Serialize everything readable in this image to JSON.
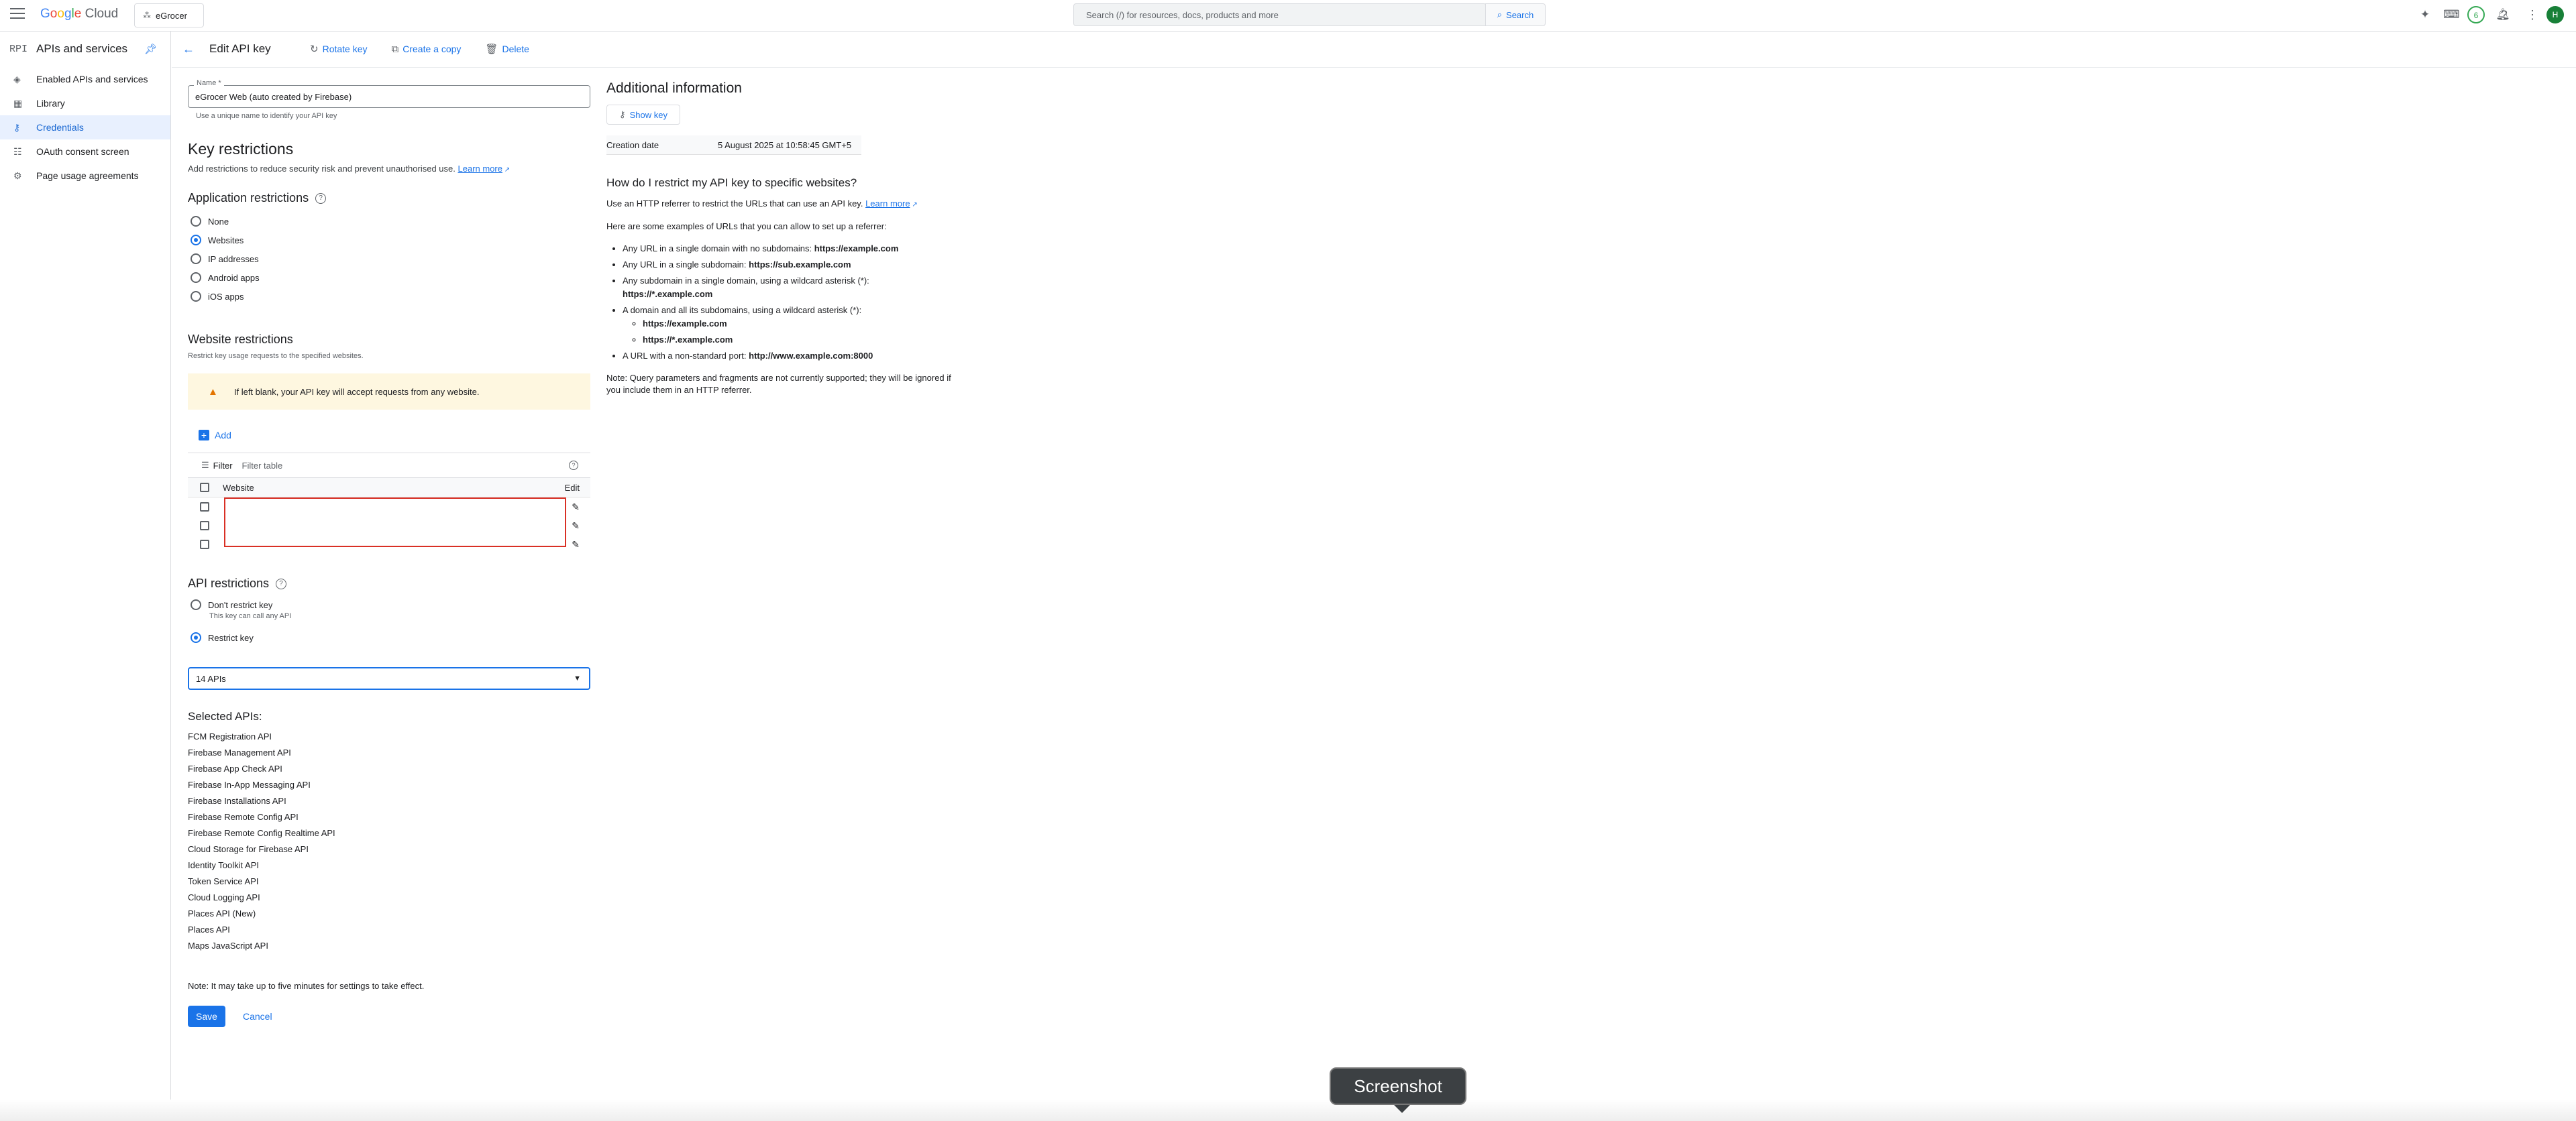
{
  "topbar": {
    "logo": "Google Cloud",
    "project": "eGrocer",
    "search_placeholder": "Search (/) for resources, docs, products and more",
    "search_button": "Search",
    "notifications_count": "6",
    "avatar_letter": "H"
  },
  "sidebar": {
    "icon_text": "RPI",
    "title": "APIs and services",
    "items": [
      {
        "label": "Enabled APIs and services",
        "icon": "diamond-icon"
      },
      {
        "label": "Library",
        "icon": "library-icon"
      },
      {
        "label": "Credentials",
        "icon": "key-icon",
        "active": true
      },
      {
        "label": "OAuth consent screen",
        "icon": "consent-icon"
      },
      {
        "label": "Page usage agreements",
        "icon": "settings-icon"
      }
    ]
  },
  "header": {
    "title": "Edit API key",
    "rotate_key": "Rotate key",
    "create_copy": "Create a copy",
    "delete": "Delete"
  },
  "name_field": {
    "label": "Name *",
    "value": "eGrocer Web (auto created by Firebase)",
    "hint": "Use a unique name to identify your API key"
  },
  "key_restrictions": {
    "title": "Key restrictions",
    "description": "Add restrictions to reduce security risk and prevent unauthorised use.",
    "learn_more": "Learn more"
  },
  "application_restrictions": {
    "title": "Application restrictions",
    "options": [
      "None",
      "Websites",
      "IP addresses",
      "Android apps",
      "iOS apps"
    ],
    "selected": "Websites"
  },
  "website_restrictions": {
    "title": "Website restrictions",
    "description": "Restrict key usage requests to the specified websites.",
    "warning": "If left blank, your API key will accept requests from any website.",
    "add_label": "Add",
    "filter_label": "Filter",
    "filter_placeholder": "Filter table",
    "col_website": "Website",
    "col_edit": "Edit"
  },
  "api_restrictions": {
    "title": "API restrictions",
    "dont_restrict": "Don't restrict key",
    "dont_restrict_sub": "This key can call any API",
    "restrict": "Restrict key",
    "selected_option": "Restrict key",
    "select_value": "14 APIs",
    "selected_title": "Selected APIs:",
    "apis": [
      "FCM Registration API",
      "Firebase Management API",
      "Firebase App Check API",
      "Firebase In-App Messaging API",
      "Firebase Installations API",
      "Firebase Remote Config API",
      "Firebase Remote Config Realtime API",
      "Cloud Storage for Firebase API",
      "Identity Toolkit API",
      "Token Service API",
      "Cloud Logging API",
      "Places API (New)",
      "Places API",
      "Maps JavaScript API"
    ]
  },
  "footer": {
    "note": "Note: It may take up to five minutes for settings to take effect.",
    "save": "Save",
    "cancel": "Cancel"
  },
  "additional": {
    "title": "Additional information",
    "show_key": "Show key",
    "creation_label": "Creation date",
    "creation_value": "5 August 2025 at 10:58:45 GMT+5",
    "howto_title": "How do I restrict my API key to specific websites?",
    "howto_p1": "Use an HTTP referrer to restrict the URLs that can use an API key.",
    "learn_more": "Learn more",
    "howto_p2": "Here are some examples of URLs that you can allow to set up a referrer:",
    "ex1_text": "Any URL in a single domain with no subdomains:",
    "ex1_url": "https://example.com",
    "ex2_text": "Any URL in a single subdomain:",
    "ex2_url": "https://sub.example.com",
    "ex3_text": "Any subdomain in a single domain, using a wildcard asterisk (*):",
    "ex3_url": "https://*.example.com",
    "ex4_text": "A domain and all its subdomains, using a wildcard asterisk (*):",
    "ex4_url1": "https://example.com",
    "ex4_url2": "https://*.example.com",
    "ex5_text": "A URL with a non-standard port:",
    "ex5_url": "http://www.example.com:8000",
    "note": "Note: Query parameters and fragments are not currently supported; they will be ignored if you include them in an HTTP referrer."
  },
  "tooltip": "Screenshot"
}
